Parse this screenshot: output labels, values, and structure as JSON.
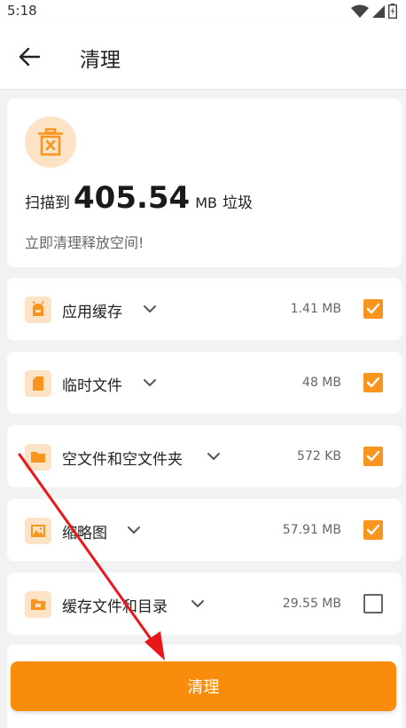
{
  "status_bar": {
    "time": "5:18",
    "icons": [
      "wifi-icon",
      "signal-icon",
      "battery-icon"
    ]
  },
  "header": {
    "title": "清理",
    "back_icon": "back-arrow-icon"
  },
  "summary": {
    "prefix": "扫描到",
    "size": "405.54",
    "unit": "MB",
    "suffix": "垃圾",
    "subtitle": "立即清理释放空间!",
    "icon": "trash-icon"
  },
  "items": [
    {
      "label": "应用缓存",
      "size": "1.41 MB",
      "checked": true,
      "icon": "app-cache-icon"
    },
    {
      "label": "临时文件",
      "size": "48 MB",
      "checked": true,
      "icon": "temp-file-icon"
    },
    {
      "label": "空文件和空文件夹",
      "size": "572 KB",
      "checked": true,
      "icon": "folder-icon"
    },
    {
      "label": "缩略图",
      "size": "57.91 MB",
      "checked": true,
      "icon": "image-icon"
    },
    {
      "label": "缓存文件和目录",
      "size": "29.55 MB",
      "checked": false,
      "icon": "cache-folder-icon"
    }
  ],
  "actions": {
    "clean_label": "清理"
  },
  "colors": {
    "accent": "#f98c0c",
    "icon_bg": "#fde3c6",
    "annotation_arrow": "#e8171b"
  }
}
